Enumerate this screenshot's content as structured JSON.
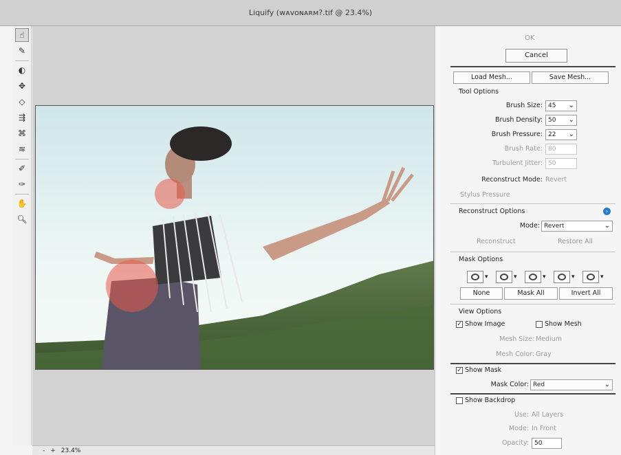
{
  "window": {
    "title": "Liquify (ᴡᴀᴠᴏɴᴀʀᴍ?.tif @ 23.4%)"
  },
  "tools": [
    "forward-warp",
    "reconstruct",
    "twirl",
    "pucker",
    "bloat",
    "push-left",
    "freeze-mask",
    "thaw-mask",
    "face",
    "hand",
    "zoom"
  ],
  "status": {
    "zoom": "23.4%",
    "zoom_minus": "-",
    "zoom_plus": "+"
  },
  "panel": {
    "ok": "OK",
    "cancel": "Cancel",
    "load_mesh": "Load Mesh...",
    "save_mesh": "Save Mesh...",
    "tool_options": {
      "heading": "Tool Options",
      "brush_size_label": "Brush Size:",
      "brush_size": "45",
      "brush_density_label": "Brush Density:",
      "brush_density": "50",
      "brush_pressure_label": "Brush Pressure:",
      "brush_pressure": "22",
      "brush_rate_label": "Brush Rate:",
      "brush_rate": "80",
      "turbulent_jitter_label": "Turbulent Jitter:",
      "turbulent_jitter": "50",
      "reconstruct_mode_label": "Reconstruct Mode:",
      "reconstruct_mode": "Revert",
      "stylus_pressure": "Stylus Pressure"
    },
    "reconstruct_options": {
      "heading": "Reconstruct Options",
      "mode_label": "Mode:",
      "mode": "Revert",
      "reconstruct": "Reconstruct",
      "restore_all": "Restore All"
    },
    "mask_options": {
      "heading": "Mask Options",
      "none": "None",
      "mask_all": "Mask All",
      "invert_all": "Invert All"
    },
    "view_options": {
      "heading": "View Options",
      "show_image": "Show Image",
      "show_mesh": "Show Mesh",
      "mesh_size_label": "Mesh Size:",
      "mesh_size": "Medium",
      "mesh_color_label": "Mesh Color:",
      "mesh_color": "Gray"
    },
    "show_mask": "Show Mask",
    "mask_color_label": "Mask Color:",
    "mask_color": "Red",
    "show_backdrop": "Show Backdrop",
    "use_label": "Use:",
    "use": "All Layers",
    "backdrop_mode_label": "Mode:",
    "backdrop_mode": "In Front",
    "opacity_label": "Opacity:",
    "opacity": "50"
  }
}
